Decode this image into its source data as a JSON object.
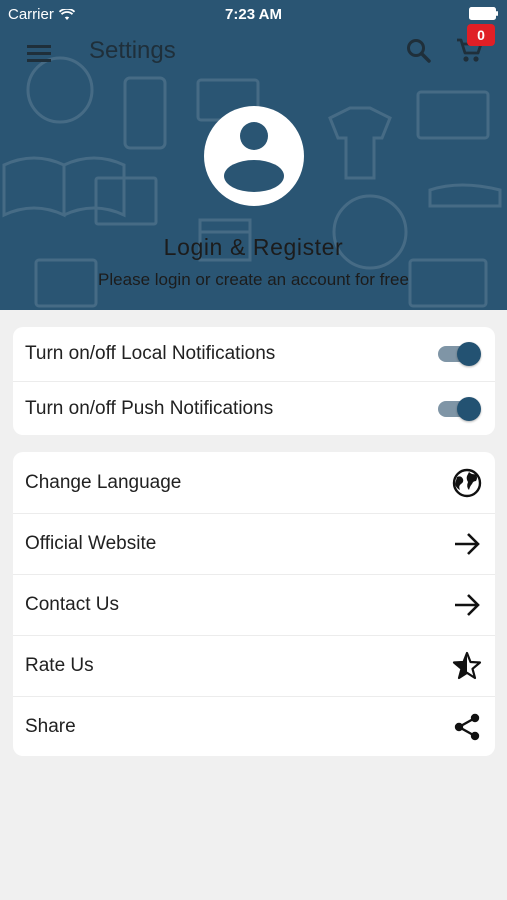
{
  "status_bar": {
    "carrier": "Carrier",
    "time": "7:23 AM"
  },
  "toolbar": {
    "title": "Settings",
    "cart_count": "0"
  },
  "profile": {
    "title": "Login & Register",
    "subtitle": "Please login or create an account for free"
  },
  "notifications": [
    {
      "label": "Turn on/off Local Notifications",
      "enabled": true
    },
    {
      "label": "Turn on/off Push Notifications",
      "enabled": true
    }
  ],
  "menu": [
    {
      "label": "Change Language",
      "icon": "globe-icon"
    },
    {
      "label": "Official Website",
      "icon": "arrow-right-icon"
    },
    {
      "label": "Contact Us",
      "icon": "arrow-right-icon"
    },
    {
      "label": "Rate Us",
      "icon": "star-half-icon"
    },
    {
      "label": "Share",
      "icon": "share-icon"
    }
  ],
  "colors": {
    "header_bg": "#2a5573",
    "toggle_thumb": "#235272",
    "toggle_track": "#7f95a6",
    "badge": "#e01f26",
    "page_bg": "#f0f0f0"
  }
}
